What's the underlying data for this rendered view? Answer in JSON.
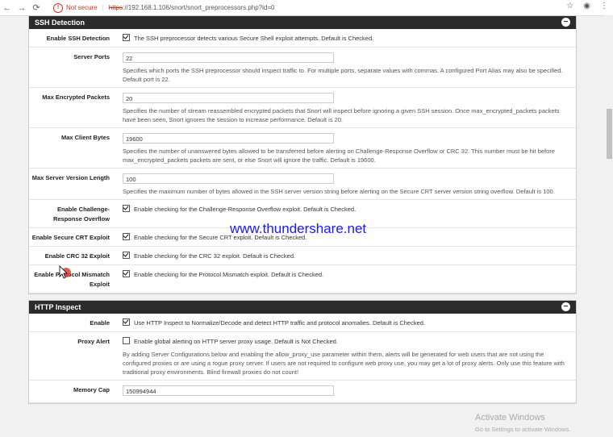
{
  "browser": {
    "not_secure": "Not secure",
    "url_https": "https",
    "url_rest": "://192.168.1.106/snort/snort_preprocessors.php?id=0"
  },
  "ssh": {
    "title": "SSH Detection",
    "rows": [
      {
        "label": "Enable SSH Detection",
        "type": "check",
        "checked": true,
        "text": "The SSH preprocessor detects various Secure Shell exploit attempts. Default is Checked."
      },
      {
        "label": "Server Ports",
        "type": "input",
        "value": "22",
        "help": "Specifies which ports the SSH preprocessor should inspect traffic to. For multiple ports, separate values with commas. A configured Port Alias may also be specified. Default port is 22."
      },
      {
        "label": "Max Encrypted Packets",
        "type": "input",
        "value": "20",
        "help": "Specifies the number of stream reassembled encrypted packets that Snort will inspect before ignoring a given SSH session. Once max_encrypted_packets packets have been seen, Snort ignores the session to increase performance. Default is 20."
      },
      {
        "label": "Max Client Bytes",
        "type": "input",
        "value": "19600",
        "help": "Specifies the number of unanswered bytes allowed to be transferred before alerting on Challenge-Response Overflow or CRC 32. This number must be hit before max_encrypted_packets packets are sent, or else Snort will ignore the traffic. Default is 19600."
      },
      {
        "label": "Max Server Version Length",
        "type": "input",
        "value": "100",
        "help": "Specifies the maximum number of bytes allowed in the SSH server version string before alerting on the Secure CRT server version string overflow. Default is 100."
      },
      {
        "label": "Enable Challenge-Response Overflow",
        "type": "check",
        "checked": true,
        "text": "Enable checking for the Challenge-Response Overflow exploit. Default is Checked."
      },
      {
        "label": "Enable Secure CRT Exploit",
        "type": "check",
        "checked": true,
        "text": "Enable checking for the Secure CRT exploit. Default is Checked."
      },
      {
        "label": "Enable CRC 32 Exploit",
        "type": "check",
        "checked": true,
        "text": "Enable checking for the CRC 32 exploit. Default is Checked."
      },
      {
        "label": "Enable Protocol Mismatch Exploit",
        "type": "check",
        "checked": true,
        "text": "Enable checking for the Protocol Mismatch exploit. Default is Checked."
      }
    ]
  },
  "http": {
    "title": "HTTP Inspect",
    "rows": [
      {
        "label": "Enable",
        "type": "check",
        "checked": true,
        "text": "Use HTTP Inspect to Normalize/Decode and detect HTTP traffic and protocol anomalies. Default is Checked."
      },
      {
        "label": "Proxy Alert",
        "type": "check",
        "checked": false,
        "text": "Enable global alerting on HTTP server proxy usage. Default is Not Checked.",
        "help": "By adding Server Configurations below and enabling the allow_proxy_use parameter within them, alerts will be generated for web users that are not using the configured proxies or are using a rogue proxy server. If users are not required to configure web proxy use, you may get a lot of proxy alerts. Only use this feature with traditional proxy environments. Blind firewall proxies do not count!"
      },
      {
        "label": "Memory Cap",
        "type": "input",
        "value": "150994944",
        "help": ""
      }
    ]
  },
  "watermark": "www.thundershare.net",
  "activate": {
    "title": "Activate Windows",
    "subtitle": "Go to Settings to activate Windows."
  }
}
